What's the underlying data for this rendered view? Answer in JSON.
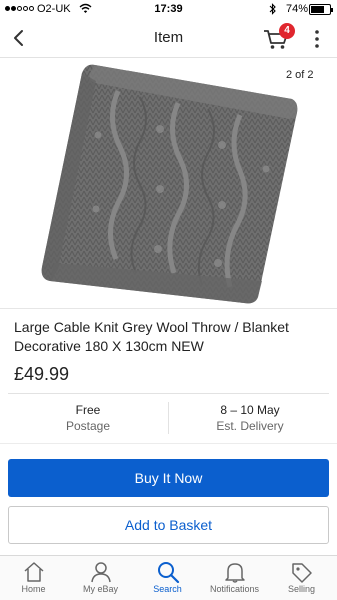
{
  "status_bar": {
    "carrier": "O2-UK",
    "time": "17:39",
    "battery": "74%",
    "battery_level": 0.74
  },
  "nav": {
    "title": "Item",
    "cart_count": "4"
  },
  "gallery": {
    "page_indicator": "2 of 2"
  },
  "item": {
    "title": "Large Cable Knit Grey Wool Throw / Blanket Decorative 180 X 130cm NEW",
    "price": "£49.99"
  },
  "shipping": {
    "cost": "Free",
    "cost_label": "Postage",
    "delivery": "8 – 10 May",
    "delivery_label": "Est. Delivery"
  },
  "actions": {
    "buy_now": "Buy It Now",
    "add_to_basket": "Add to Basket"
  },
  "tabs": [
    {
      "label": "Home",
      "icon": "home-icon"
    },
    {
      "label": "My eBay",
      "icon": "person-icon"
    },
    {
      "label": "Search",
      "icon": "search-icon"
    },
    {
      "label": "Notifications",
      "icon": "bell-icon"
    },
    {
      "label": "Selling",
      "icon": "tag-icon"
    }
  ],
  "colors": {
    "accent": "#0b5fce",
    "badge": "#e0262e",
    "blanket": "#6f6f6f"
  }
}
